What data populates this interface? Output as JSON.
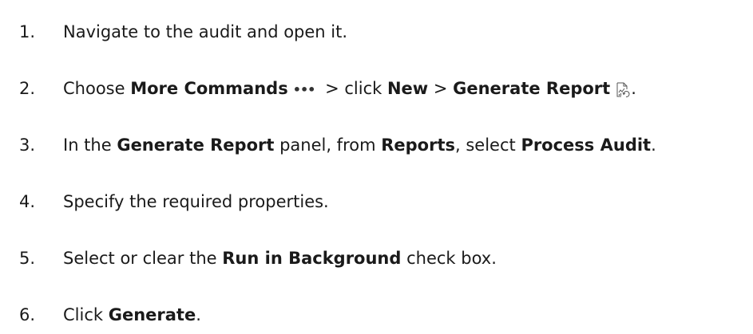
{
  "steps": [
    {
      "number": "1.",
      "parts": {
        "t1": "Navigate to the audit and open it."
      }
    },
    {
      "number": "2.",
      "parts": {
        "t1": "Choose ",
        "b1": "More Commands",
        "icon1": "•••",
        "t2": " > click ",
        "b2": "New",
        "t3": " > ",
        "b3": "Generate Report",
        "t4": "."
      },
      "icons": [
        "more-commands-ellipsis-icon",
        "generate-report-icon"
      ]
    },
    {
      "number": "3.",
      "parts": {
        "t1": "In the ",
        "b1": "Generate Report",
        "t2": " panel, from ",
        "b2": "Reports",
        "t3": ", select ",
        "b3": "Process Audit",
        "t4": "."
      }
    },
    {
      "number": "4.",
      "parts": {
        "t1": "Specify the required properties."
      }
    },
    {
      "number": "5.",
      "parts": {
        "t1": "Select or clear the ",
        "b1": "Run in Background",
        "t2": " check box."
      }
    },
    {
      "number": "6.",
      "parts": {
        "t1": "Click ",
        "b1": "Generate",
        "t2": "."
      }
    }
  ]
}
